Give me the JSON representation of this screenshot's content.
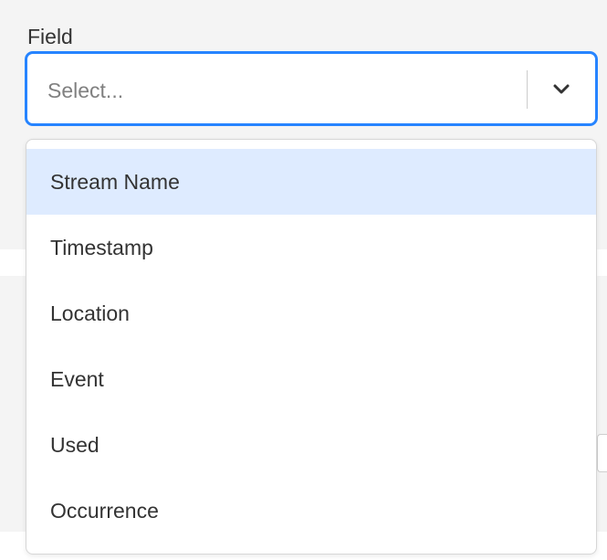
{
  "field": {
    "label": "Field",
    "placeholder": "Select...",
    "indicator_icon": "chevron-down-icon"
  },
  "menu": {
    "focused_index": 0,
    "options": [
      {
        "label": "Stream Name"
      },
      {
        "label": "Timestamp"
      },
      {
        "label": "Location"
      },
      {
        "label": "Event"
      },
      {
        "label": "Used"
      },
      {
        "label": "Occurrence"
      }
    ]
  },
  "colors": {
    "focus_border": "#2684ff",
    "option_highlight": "#deebff",
    "text": "#333333",
    "placeholder": "#808080"
  }
}
